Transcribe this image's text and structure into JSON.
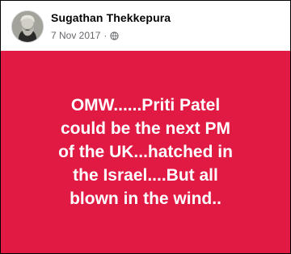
{
  "post": {
    "author": "Sugathan Thekkepura",
    "date": "7 Nov 2017",
    "separator": "·",
    "privacy_icon": "globe-icon",
    "avatar_icon": "profile-avatar",
    "background_color": "#e11a44",
    "text_color": "#ffffff",
    "body_text": "OMW......Priti Patel\ncould be the next   PM\nof the  UK...hatched in\nthe  Israel....But all\nblown in the wind.."
  }
}
